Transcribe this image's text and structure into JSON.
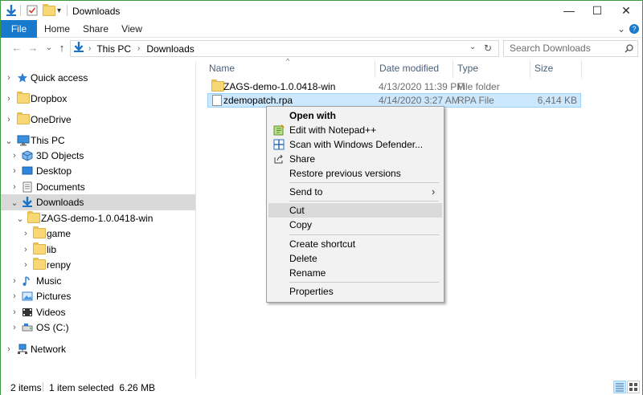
{
  "window": {
    "title": "Downloads"
  },
  "title_controls": {
    "minimize": "—",
    "maximize": "☐",
    "close": "✕"
  },
  "ribbon": {
    "tabs": [
      "File",
      "Home",
      "Share",
      "View"
    ],
    "expand": "⌄",
    "help": "?"
  },
  "nav": {
    "back": "←",
    "forward": "→",
    "recent": "⌄",
    "up": "↑"
  },
  "address": {
    "crumbs": [
      "This PC",
      "Downloads"
    ],
    "dropdown": "⌄",
    "refresh": "↻"
  },
  "search": {
    "placeholder": "Search Downloads"
  },
  "tree": [
    {
      "label": "Quick access",
      "icon": "star-icon"
    },
    {
      "label": "Dropbox",
      "icon": "folder-icon"
    },
    {
      "label": "OneDrive",
      "icon": "folder-icon"
    },
    {
      "label": "This PC",
      "icon": "computer-icon"
    },
    {
      "label": "3D Objects",
      "icon": "3d-objects-icon"
    },
    {
      "label": "Desktop",
      "icon": "desktop-icon"
    },
    {
      "label": "Documents",
      "icon": "documents-icon"
    },
    {
      "label": "Downloads",
      "icon": "download-arrow-icon"
    },
    {
      "label": "ZAGS-demo-1.0.0418-win",
      "icon": "folder-icon"
    },
    {
      "label": "game",
      "icon": "folder-icon"
    },
    {
      "label": "lib",
      "icon": "folder-icon"
    },
    {
      "label": "renpy",
      "icon": "folder-icon"
    },
    {
      "label": "Music",
      "icon": "music-icon"
    },
    {
      "label": "Pictures",
      "icon": "pictures-icon"
    },
    {
      "label": "Videos",
      "icon": "videos-icon"
    },
    {
      "label": "OS (C:)",
      "icon": "drive-icon"
    },
    {
      "label": "Network",
      "icon": "network-icon"
    }
  ],
  "columns": [
    "Name",
    "Date modified",
    "Type",
    "Size"
  ],
  "files": [
    {
      "name": "ZAGS-demo-1.0.0418-win",
      "date": "4/13/2020 11:39 PM",
      "type": "File folder",
      "size": ""
    },
    {
      "name": "zdemopatch.rpa",
      "date": "4/14/2020 3:27 AM",
      "type": "RPA File",
      "size": "6,414 KB"
    }
  ],
  "context_menu": {
    "open_with": "Open with",
    "edit_notepad": "Edit with Notepad++",
    "scan_defender": "Scan with Windows Defender...",
    "share": "Share",
    "restore": "Restore previous versions",
    "send_to": "Send to",
    "cut": "Cut",
    "copy": "Copy",
    "create_shortcut": "Create shortcut",
    "delete": "Delete",
    "rename": "Rename",
    "properties": "Properties"
  },
  "status": {
    "items": "2 items",
    "selected": "1 item selected  6.26 MB"
  },
  "colors": {
    "accent": "#1979ca",
    "selection": "#cce8ff",
    "selection_border": "#99d1ff",
    "border": "#3c9b3c"
  }
}
